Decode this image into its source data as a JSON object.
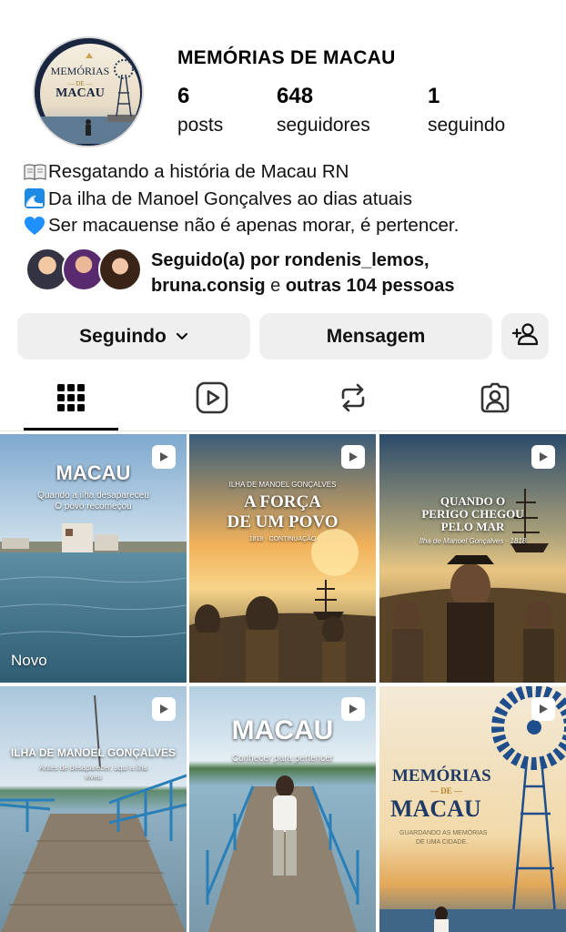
{
  "profile": {
    "username": "MEMÓRIAS DE MACAU",
    "avatar_text_top": "MEMÓRIAS",
    "avatar_text_mid": "— DE —",
    "avatar_text_bottom": "MACAU",
    "stats": [
      {
        "value": "6",
        "label": "posts"
      },
      {
        "value": "648",
        "label": "seguidores"
      },
      {
        "value": "1",
        "label": "seguindo"
      }
    ],
    "bio": [
      {
        "icon": "open-book-emoji",
        "text": "Resgatando a história de  Macau RN"
      },
      {
        "icon": "wave-emoji",
        "text": "Da ilha de Manoel Gonçalves ao dias atuais"
      },
      {
        "icon": "blue-heart-emoji",
        "text": "Ser macauense não é apenas morar, é pertencer."
      }
    ],
    "mutual": {
      "prefix": "Seguido(a) por ",
      "user1": "rondenis_lemos,",
      "user2": "bruna.consig",
      "middle": " e ",
      "others": "outras 104 pessoas"
    }
  },
  "actions": {
    "following_label": "Seguindo",
    "message_label": "Mensagem"
  },
  "tabs": [
    "grid-icon",
    "reels-icon",
    "reposts-icon",
    "tagged-icon"
  ],
  "posts": [
    {
      "title": "MACAU",
      "sub1": "Quando a ilha desapareceu",
      "sub2": "O povo recomeçou",
      "badge": "Novo"
    },
    {
      "title_small": "ILHA DE MANOEL GONÇALVES",
      "title": "A FORÇA",
      "title2": "DE UM POVO",
      "sub1": "1818 · CONTINUAÇÃO"
    },
    {
      "title": "QUANDO O",
      "title2": "PERIGO CHEGOU",
      "title3": "PELO MAR",
      "sub1": "Ilha de Manoel Gonçalves · 1818"
    },
    {
      "title": "ILHA DE MANOEL GONÇALVES",
      "sub1": "Antes de desaparecer, aqui a ilha",
      "sub2": "viveu"
    },
    {
      "title": "MACAU",
      "sub1": "Conhecer para pertencer"
    },
    {
      "title": "MEMÓRIAS",
      "title2": "— DE —",
      "title3": "MACAU",
      "sub1": "GUARDANDO AS MEMÓRIAS",
      "sub2": "DE UMA CIDADE."
    }
  ],
  "colors": {
    "button_bg": "#efefef",
    "text": "#000000",
    "bio_heart": "#1e90ff"
  }
}
